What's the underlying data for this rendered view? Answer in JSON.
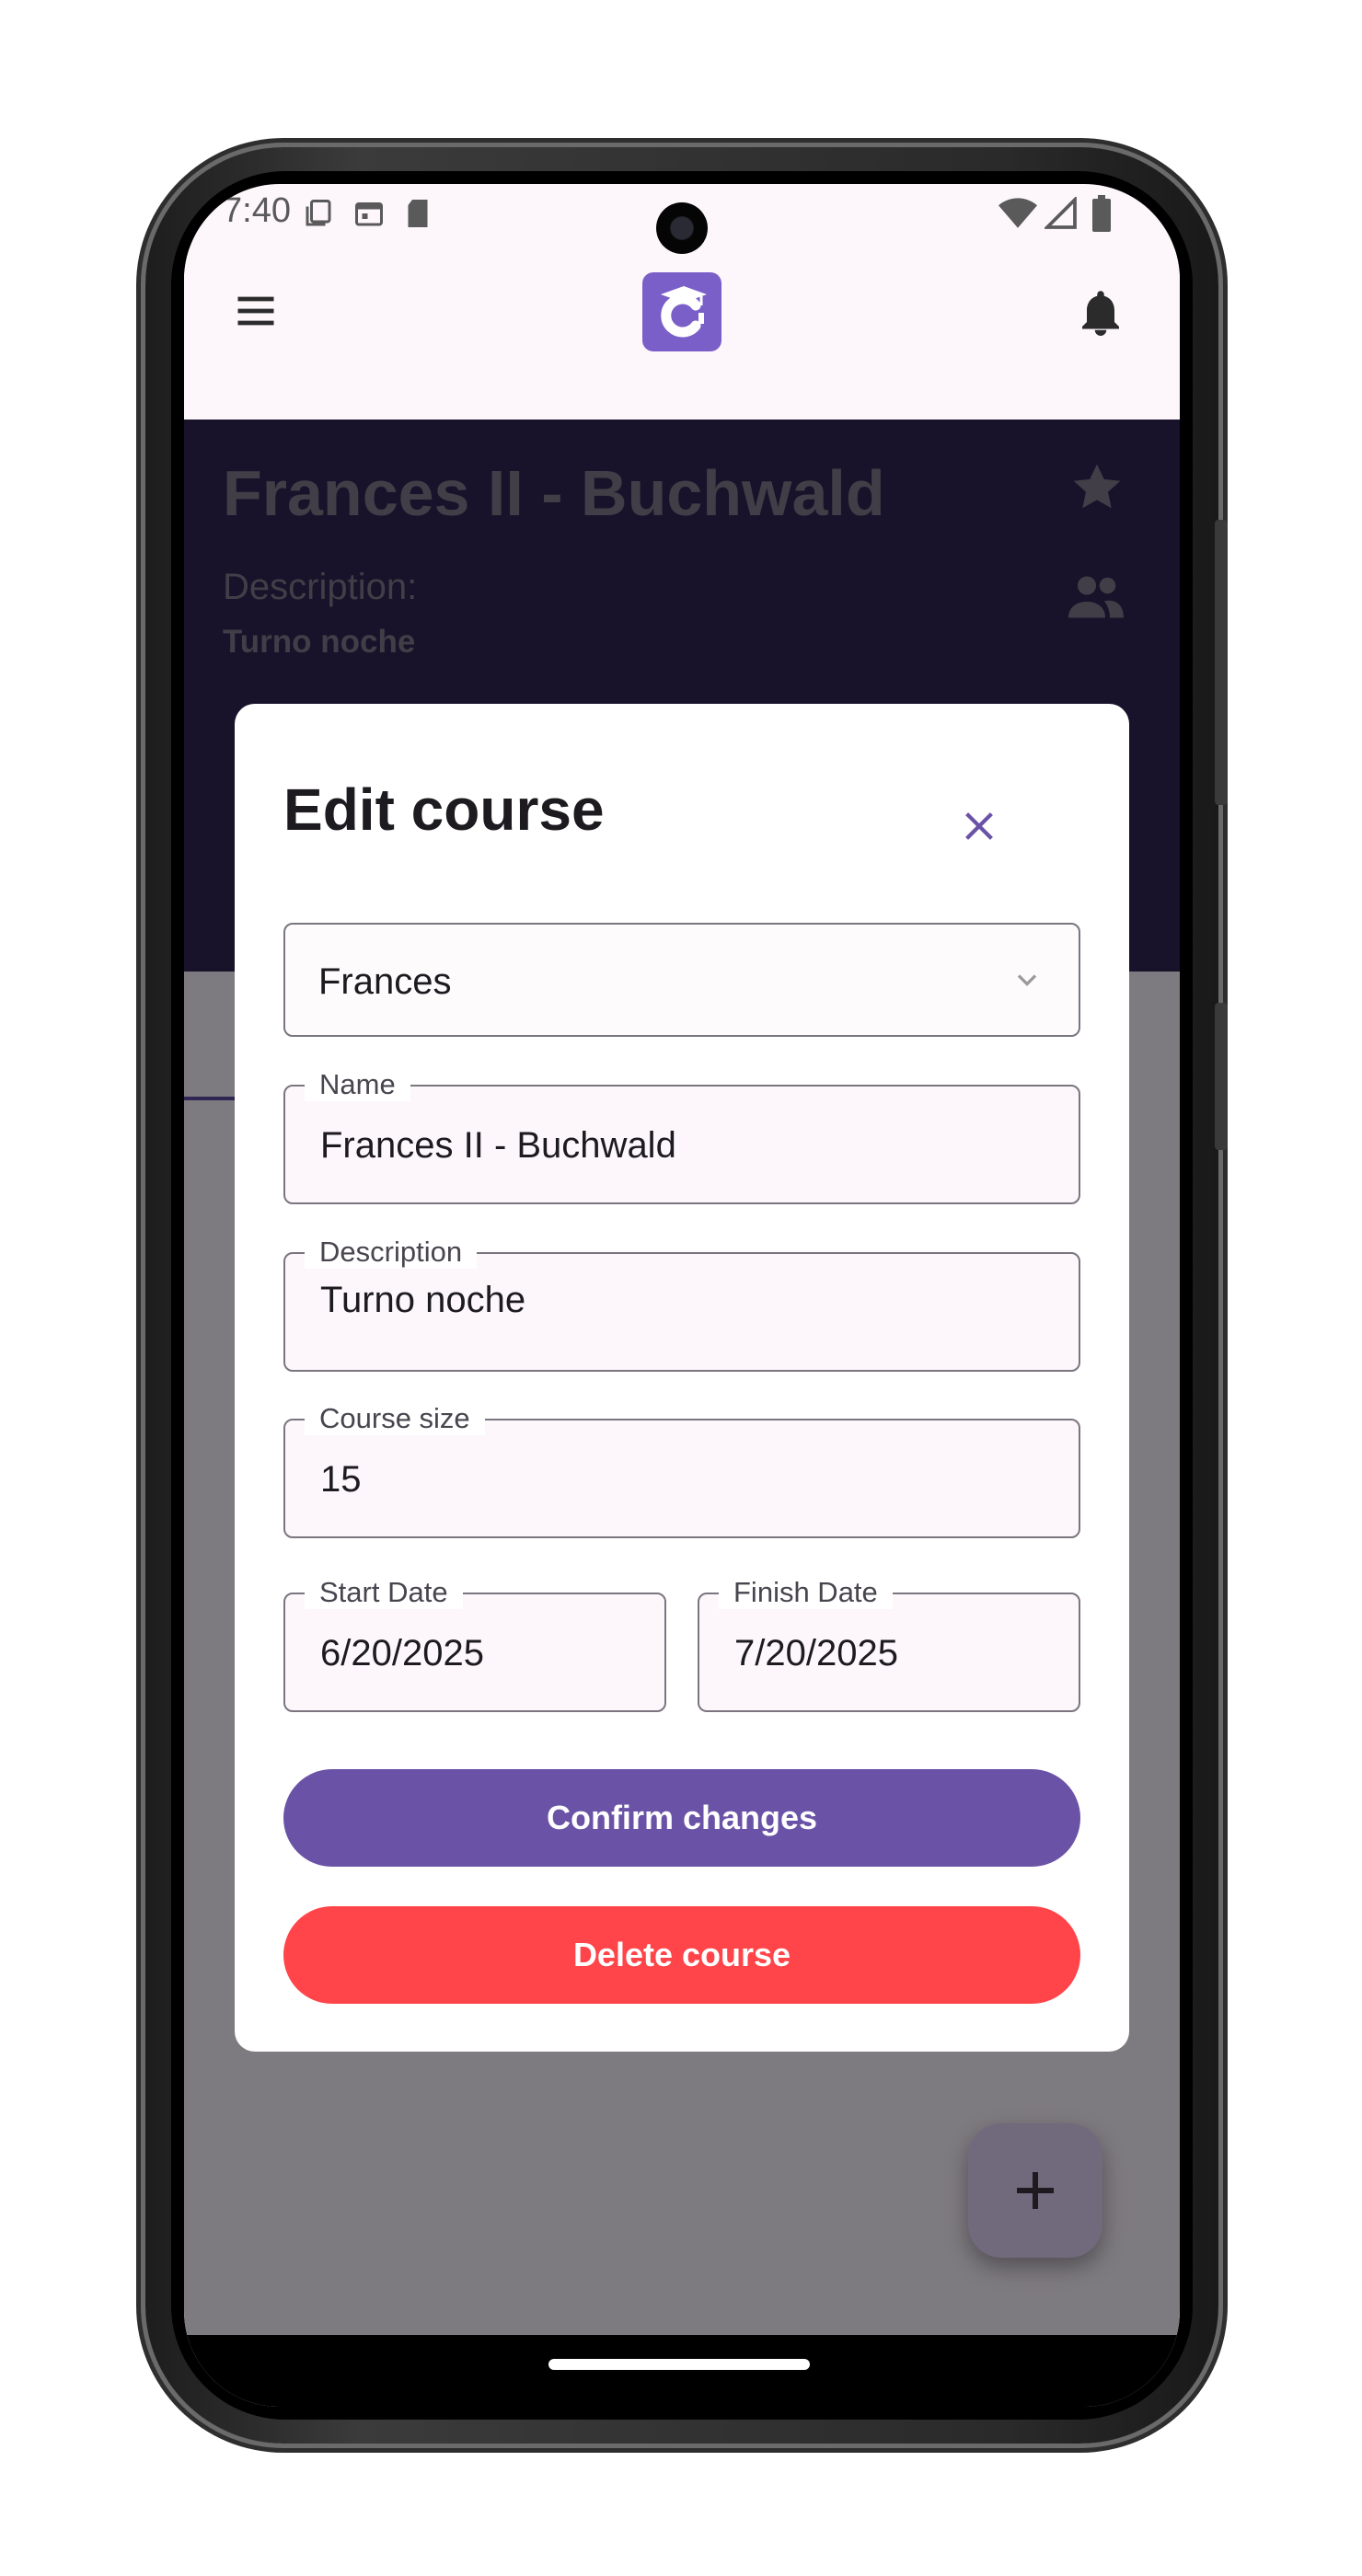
{
  "status_bar": {
    "time": "7:40"
  },
  "course": {
    "title": "Frances II - Buchwald",
    "description_label": "Description:",
    "description_value": "Turno noche"
  },
  "dialog": {
    "title": "Edit course",
    "language_select": {
      "value": "Frances"
    },
    "fields": {
      "name": {
        "label": "Name",
        "value": "Frances II - Buchwald"
      },
      "description": {
        "label": "Description",
        "value": "Turno noche"
      },
      "course_size": {
        "label": "Course size",
        "value": "15"
      },
      "start_date": {
        "label": "Start Date",
        "value": "6/20/2025"
      },
      "finish_date": {
        "label": "Finish Date",
        "value": "7/20/2025"
      }
    },
    "confirm_label": "Confirm changes",
    "delete_label": "Delete course"
  },
  "colors": {
    "primary": "#6a52a6",
    "header_background": "#302654",
    "danger": "#ff4549",
    "logo": "#7b5fc8"
  },
  "icons": {
    "menu": "menu-icon",
    "logo": "app-logo",
    "notifications": "bell-icon",
    "favorite": "star-icon",
    "students": "people-icon",
    "close": "close-icon",
    "dropdown": "chevron-down-icon",
    "add": "plus-icon"
  }
}
